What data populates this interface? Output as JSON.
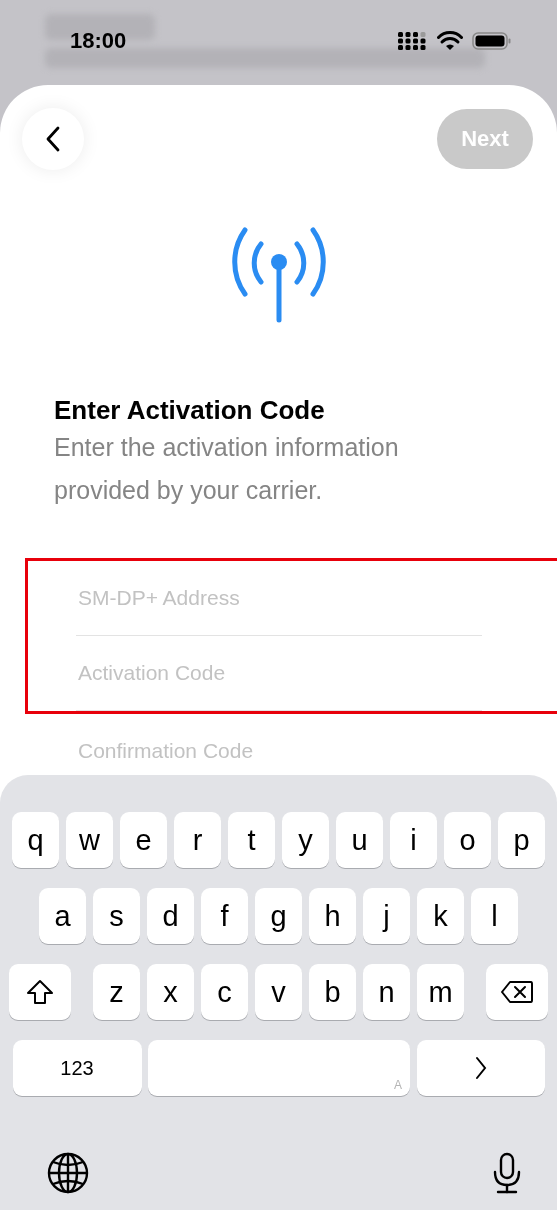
{
  "status_bar": {
    "time": "18:00"
  },
  "next_button": {
    "label": "Next",
    "disabled": true
  },
  "title": "Enter Activation Code",
  "subtitle": "Enter the activation information provided by your carrier.",
  "fields": [
    {
      "placeholder": "SM-DP+ Address",
      "highlighted": true
    },
    {
      "placeholder": "Activation Code",
      "highlighted": true
    },
    {
      "placeholder": "Confirmation Code",
      "highlighted": false
    }
  ],
  "keyboard": {
    "rows": [
      [
        "q",
        "w",
        "e",
        "r",
        "t",
        "y",
        "u",
        "i",
        "o",
        "p"
      ],
      [
        "a",
        "s",
        "d",
        "f",
        "g",
        "h",
        "j",
        "k",
        "l"
      ],
      [
        "z",
        "x",
        "c",
        "v",
        "b",
        "n",
        "m"
      ]
    ],
    "numbers_key": "123",
    "space_hint": "A"
  }
}
